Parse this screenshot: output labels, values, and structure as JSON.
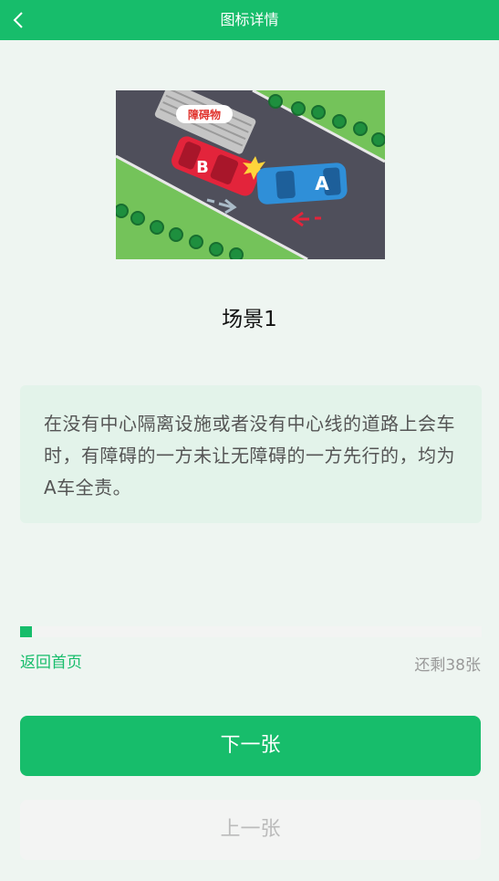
{
  "header": {
    "title": "图标详情",
    "back_icon": "chevron-left-icon",
    "color": "#17bd6b"
  },
  "scene": {
    "image_label": "障碍物",
    "car_b": "B",
    "car_a": "A",
    "title": "场景1",
    "description": "在没有中心隔离设施或者没有中心线的道路上会车时，有障碍的一方未让无障碍的一方先行的，均为A车全责。"
  },
  "progress": {
    "fraction": 0.026,
    "home_label": "返回首页",
    "remaining": "还剩38张"
  },
  "buttons": {
    "next_label": "下一张",
    "prev_label": "上一张"
  }
}
